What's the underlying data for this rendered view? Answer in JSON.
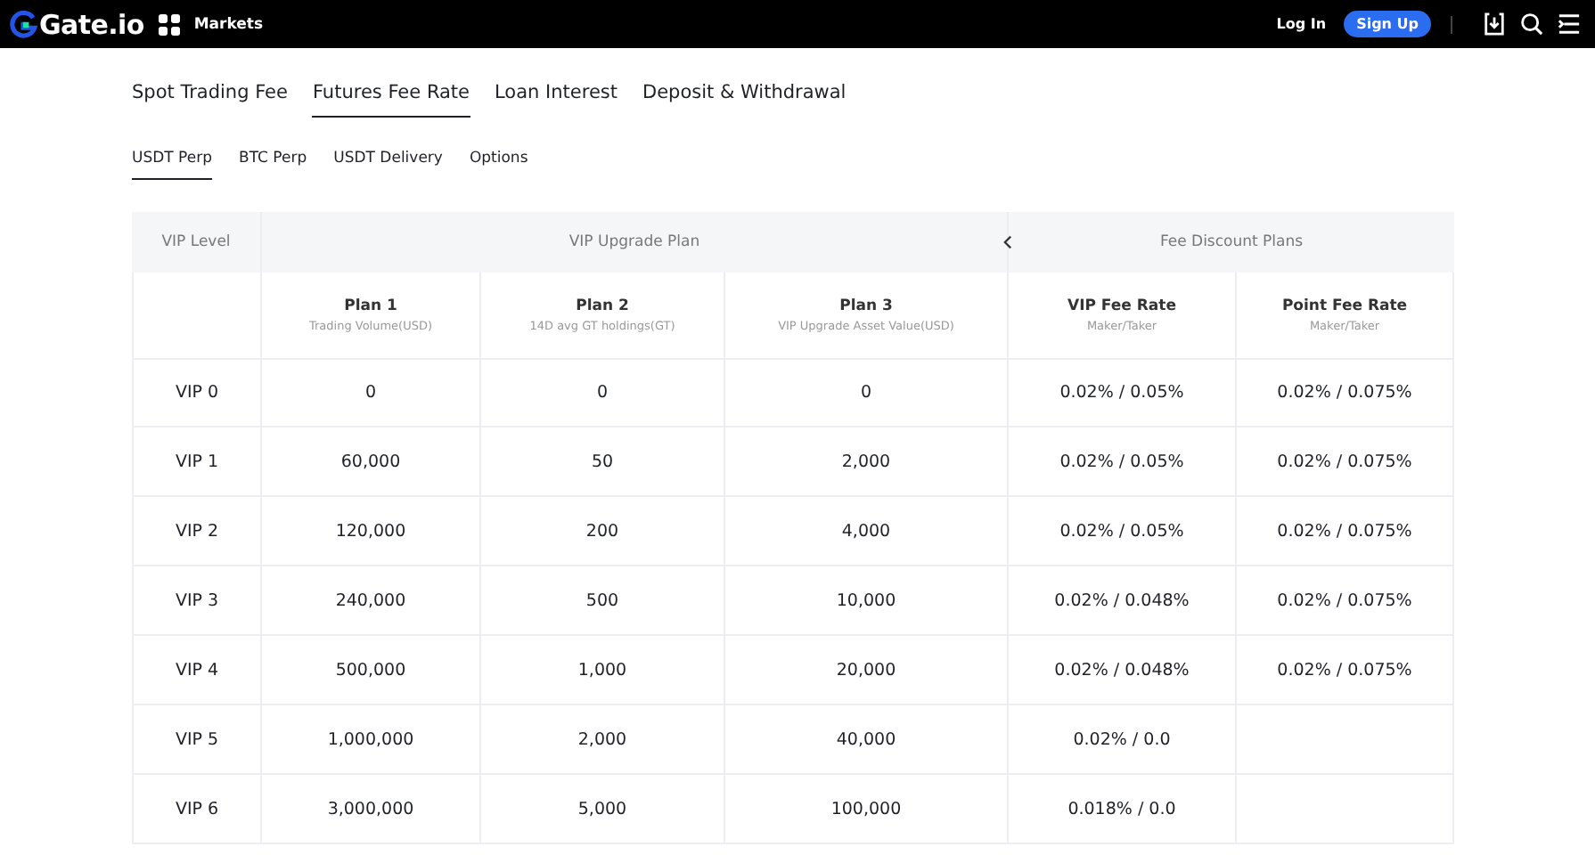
{
  "header": {
    "logo": "Gate.io",
    "nav": "Markets",
    "login": "Log In",
    "signup": "Sign Up"
  },
  "tabs": [
    {
      "label": "Spot Trading Fee",
      "selected": false
    },
    {
      "label": "Futures Fee Rate",
      "selected": true
    },
    {
      "label": "Loan Interest",
      "selected": false
    },
    {
      "label": "Deposit & Withdrawal",
      "selected": false
    }
  ],
  "subtabs": [
    {
      "label": "USDT Perp",
      "selected": true
    },
    {
      "label": "BTC Perp",
      "selected": false
    },
    {
      "label": "USDT Delivery",
      "selected": false
    },
    {
      "label": "Options",
      "selected": false
    }
  ],
  "table": {
    "group_headers": {
      "upgrade": "VIP Upgrade Plan",
      "discount": "Fee Discount Plans"
    },
    "columns": [
      {
        "header": "VIP Level"
      },
      {
        "title": "Plan 1",
        "subtitle": "Trading Volume(USD)"
      },
      {
        "title": "Plan 2",
        "subtitle": "14D avg GT holdings(GT)"
      },
      {
        "title": "Plan 3",
        "subtitle": "VIP Upgrade Asset Value(USD)"
      },
      {
        "title": "VIP Fee Rate",
        "subtitle": "Maker/Taker"
      },
      {
        "title": "Point Fee Rate",
        "subtitle": "Maker/Taker"
      }
    ],
    "rows": [
      [
        "VIP 0",
        "0",
        "0",
        "0",
        "0.02% / 0.05%",
        "0.02% / 0.075%"
      ],
      [
        "VIP 1",
        "60,000",
        "50",
        "2,000",
        "0.02% / 0.05%",
        "0.02% / 0.075%"
      ],
      [
        "VIP 2",
        "120,000",
        "200",
        "4,000",
        "0.02% / 0.05%",
        "0.02% / 0.075%"
      ],
      [
        "VIP 3",
        "240,000",
        "500",
        "10,000",
        "0.02% / 0.048%",
        "0.02% / 0.075%"
      ],
      [
        "VIP 4",
        "500,000",
        "1,000",
        "20,000",
        "0.02% / 0.048%",
        "0.02% / 0.075%"
      ],
      [
        "VIP 5",
        "1,000,000",
        "2,000",
        "40,000",
        "0.02% / 0.0"
      ],
      [
        "VIP 6",
        "3,000,000",
        "5,000",
        "100,000",
        "0.018% / 0.0"
      ]
    ]
  }
}
